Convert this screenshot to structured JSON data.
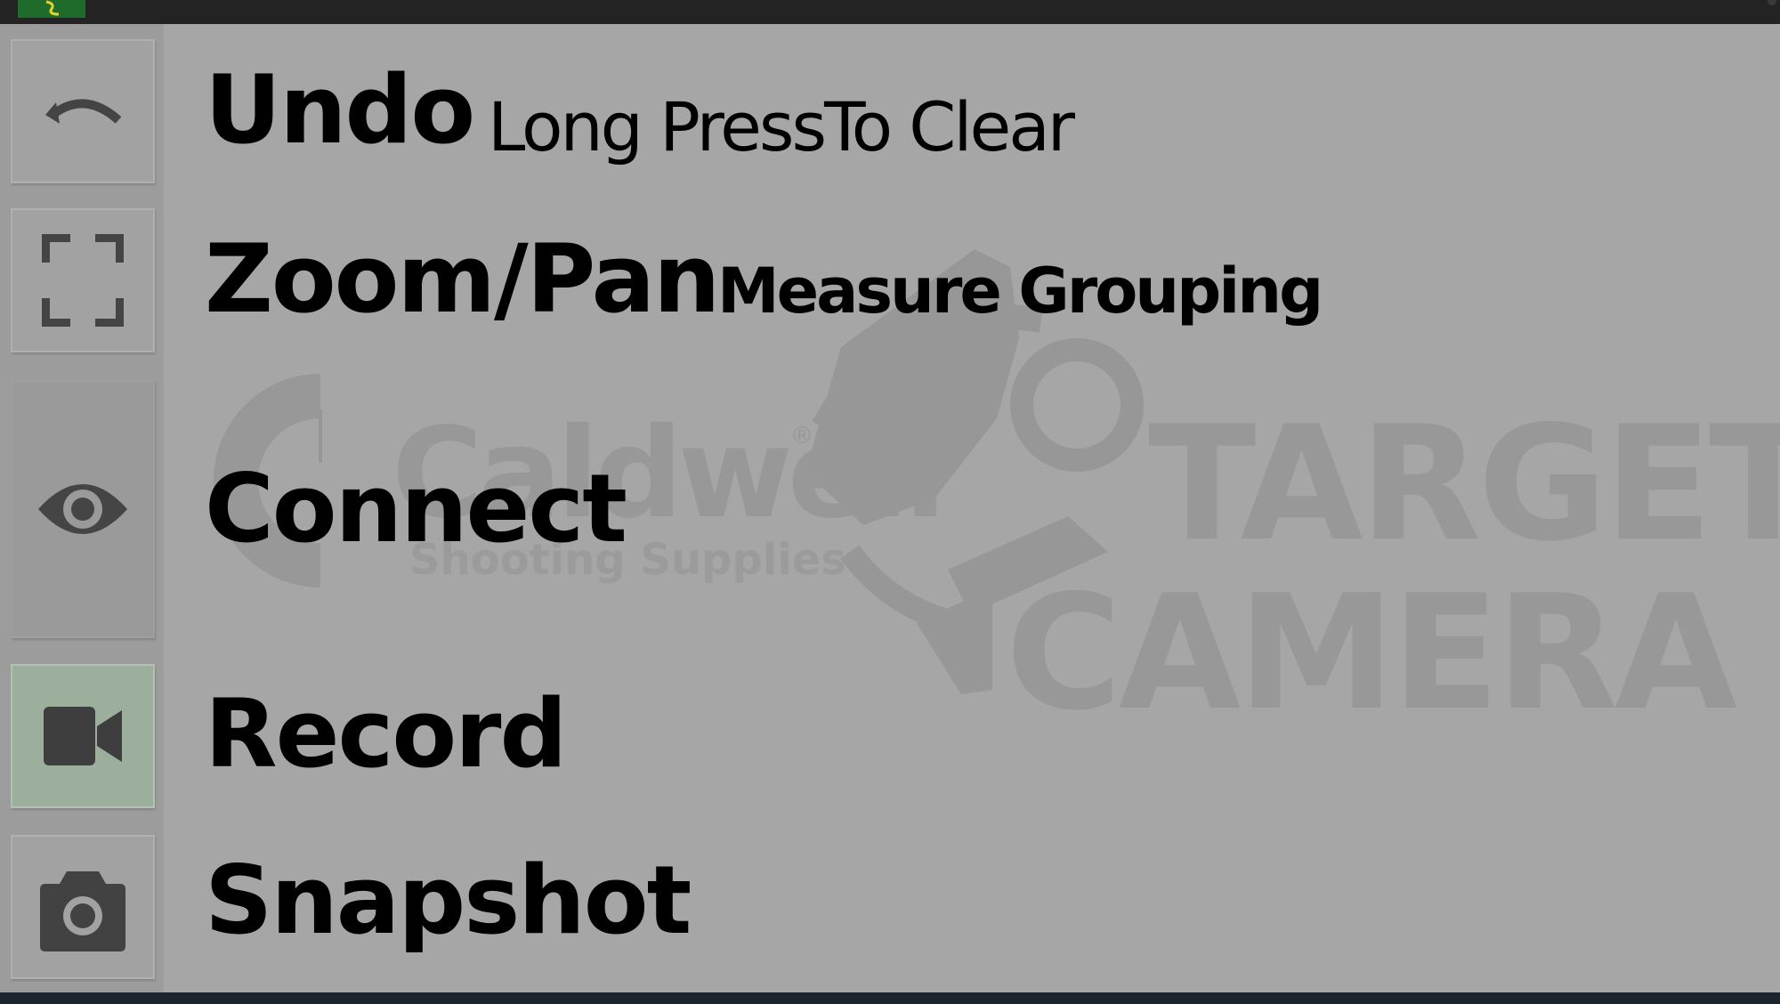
{
  "status_bar": {
    "app_icon": "app-launcher-icon"
  },
  "toolbar": {
    "items": [
      {
        "label": "Undo",
        "sublabel": "Long PressTo Clear",
        "icon": "undo-icon"
      },
      {
        "label": "Zoom/Pan",
        "sublabel": "Measure Grouping",
        "icon": "fullscreen-icon"
      },
      {
        "label": "Connect",
        "sublabel": "",
        "icon": "eye-icon"
      },
      {
        "label": "Record",
        "sublabel": "",
        "icon": "video-camera-icon"
      },
      {
        "label": "Snapshot",
        "sublabel": "",
        "icon": "camera-icon"
      }
    ]
  },
  "watermark": {
    "brand": "Caldwell",
    "registered": "®",
    "tagline": "Shooting Supplies",
    "product_line1": "TARGET",
    "product_line2": "CAMERA"
  },
  "colors": {
    "overlay_gray": "#a6a6a6",
    "record_active_green": "#9cae9c",
    "status_bar": "#232323",
    "app_icon_green": "#1e6b2c"
  }
}
